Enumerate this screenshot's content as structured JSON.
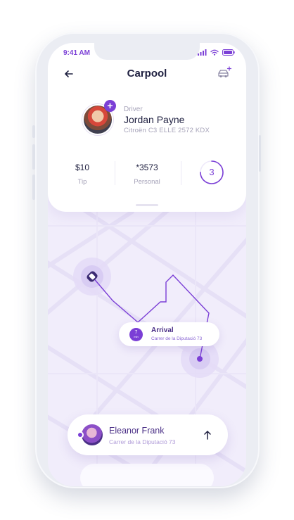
{
  "status_bar": {
    "time": "9:41 AM"
  },
  "header": {
    "title": "Carpool",
    "back_icon": "arrow-left-icon",
    "car_icon": "car-plus-icon"
  },
  "driver": {
    "role": "Driver",
    "name": "Jordan Payne",
    "car": "Citroën C3 ELLE 2572 KDX",
    "badge_icon": "plus-icon"
  },
  "stats": [
    {
      "value": "$10",
      "label": "Tip"
    },
    {
      "value": "*3573",
      "label": "Personal"
    }
  ],
  "counter": {
    "value": "3",
    "progress": 0.75
  },
  "arrival": {
    "minutes": "7",
    "unit": "min",
    "title": "Arrival",
    "address": "Carrer de la Diputació 73"
  },
  "passenger": {
    "name": "Eleanor Frank",
    "address": "Carrer de la Diputació 73",
    "action_icon": "arrow-up-icon"
  },
  "colors": {
    "accent": "#7b3fd6",
    "text": "#1f2040",
    "muted": "#a5a2b8",
    "map_bg": "#f1edfb"
  }
}
